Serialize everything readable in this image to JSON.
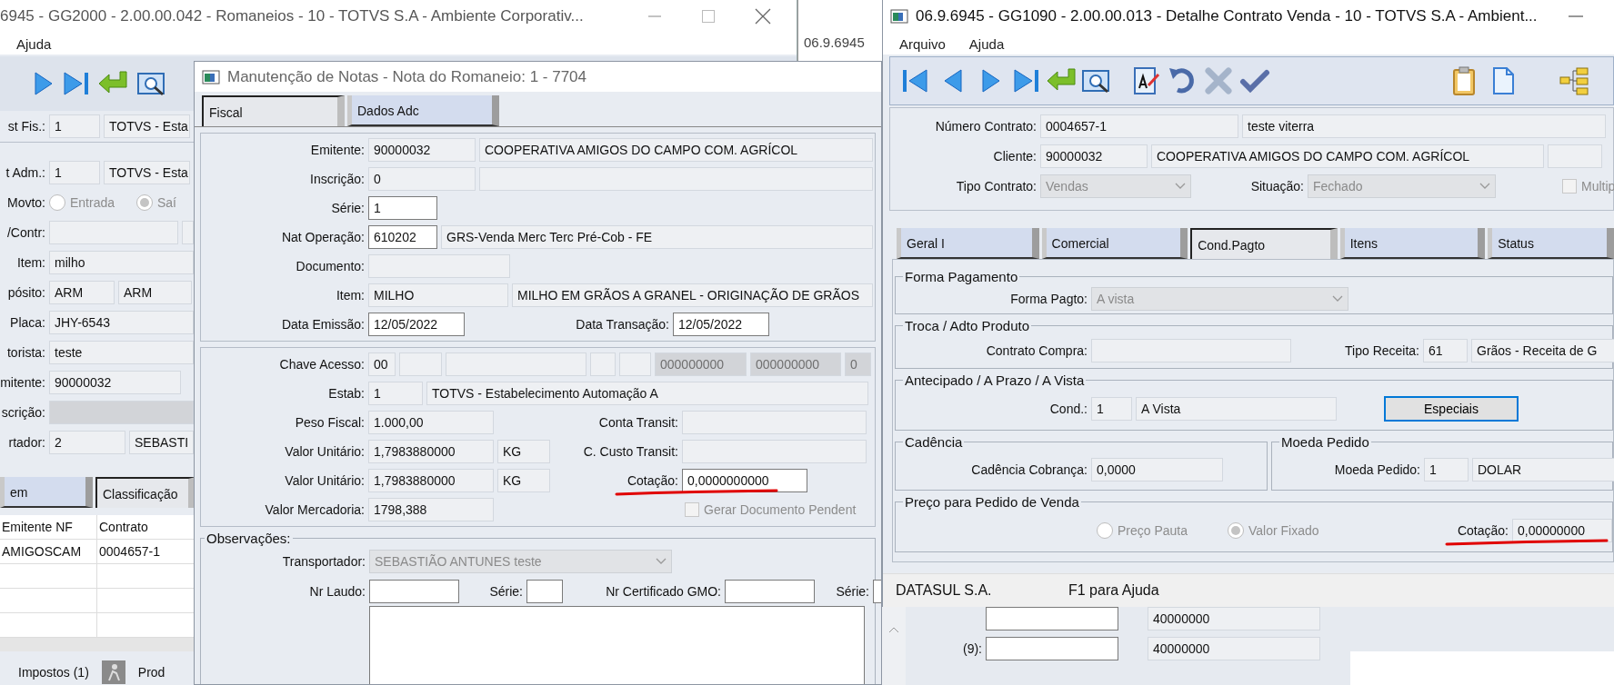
{
  "romaneios_window": {
    "title": "6945 - GG2000 - 2.00.00.042 - Romaneios - 10 - TOTVS S.A - Ambiente Corporativ...",
    "menu": [
      "Ajuda"
    ],
    "rows": [
      {
        "items": [
          {
            "kind": "label",
            "text": "st Fis.:"
          },
          {
            "kind": "readonly",
            "value": "1"
          },
          {
            "kind": "readonly",
            "value": "TOTVS - Esta"
          }
        ]
      },
      {
        "items": [
          {
            "kind": "label",
            "text": "t Adm.:"
          },
          {
            "kind": "readonly",
            "value": "1"
          },
          {
            "kind": "readonly",
            "value": "TOTVS - Esta"
          }
        ]
      },
      {
        "items": [
          {
            "kind": "label",
            "text": "Movto:"
          },
          {
            "kind": "radio",
            "label": "Entrada",
            "selected": false,
            "disabled": true
          },
          {
            "kind": "radio",
            "label": "Saí",
            "selected": true,
            "disabled": true
          }
        ]
      },
      {
        "items": [
          {
            "kind": "label",
            "text": "/Contr:"
          },
          {
            "kind": "readonly"
          },
          {
            "kind": "readonly"
          }
        ]
      },
      {
        "items": [
          {
            "kind": "label",
            "text": "Item:"
          },
          {
            "kind": "readonly",
            "value": "milho"
          }
        ]
      },
      {
        "items": [
          {
            "kind": "label",
            "text": "pósito:"
          },
          {
            "kind": "readonly",
            "value": "ARM"
          },
          {
            "kind": "readonly",
            "value": "ARM"
          }
        ]
      },
      {
        "items": [
          {
            "kind": "label",
            "text": "Placa:"
          },
          {
            "kind": "readonly",
            "value": "JHY-6543"
          }
        ]
      },
      {
        "items": [
          {
            "kind": "label",
            "text": "torista:"
          },
          {
            "kind": "readonly",
            "value": "teste"
          }
        ]
      },
      {
        "items": [
          {
            "kind": "label",
            "text": "mitente:"
          },
          {
            "kind": "readonly",
            "value": "90000032"
          }
        ]
      },
      {
        "items": [
          {
            "kind": "label",
            "text": "scrição:"
          },
          {
            "kind": "readonly",
            "disabled": true
          }
        ]
      },
      {
        "items": [
          {
            "kind": "label",
            "text": "rtador:"
          },
          {
            "kind": "readonly",
            "value": "2"
          },
          {
            "kind": "readonly",
            "value": "SEBASTI"
          }
        ]
      }
    ],
    "tabs": [
      {
        "label": "em",
        "selected": false
      },
      {
        "label": "Classificação",
        "selected": true
      }
    ],
    "table": {
      "columns": [
        "Emitente NF",
        "Contrato"
      ],
      "rows": [
        [
          "AMIGOSCAM",
          "0004657-1"
        ]
      ]
    },
    "bottom_bar": [
      "Impostos (1)",
      "Prod"
    ]
  },
  "background_window": {
    "title": "06.9.6945"
  },
  "behind_panel": {
    "rows": [
      {
        "items": [
          {
            "kind": "input"
          },
          {
            "kind": "readonly",
            "value": "40000000"
          }
        ]
      },
      {
        "items": [
          {
            "kind": "label",
            "text": "(9):"
          },
          {
            "kind": "input"
          },
          {
            "kind": "readonly",
            "value": "40000000"
          }
        ]
      }
    ]
  },
  "notes_window": {
    "title": "Manutenção de Notas - Nota do Romaneio: 1 - 7704",
    "tabs": [
      {
        "label": "Fiscal",
        "selected": true
      },
      {
        "label": "Dados Adc",
        "selected": false
      }
    ],
    "groups": [
      {
        "rows": [
          {
            "items": [
              {
                "kind": "label",
                "text": "Emitente:"
              },
              {
                "kind": "readonly",
                "value": "90000032"
              },
              {
                "kind": "readonly",
                "value": "COOPERATIVA AMIGOS DO CAMPO COM. AGRÍCOL"
              }
            ]
          },
          {
            "items": [
              {
                "kind": "label",
                "text": "Inscrição:"
              },
              {
                "kind": "readonly",
                "value": "0"
              },
              {
                "kind": "readonly"
              }
            ]
          },
          {
            "items": [
              {
                "kind": "label",
                "text": "Série:"
              },
              {
                "kind": "input",
                "value": "1"
              }
            ]
          },
          {
            "items": [
              {
                "kind": "label",
                "text": "Nat Operação:"
              },
              {
                "kind": "input",
                "value": "610202"
              },
              {
                "kind": "readonly",
                "value": "GRS-Venda Merc Terc Pré-Cob - FE"
              }
            ]
          },
          {
            "items": [
              {
                "kind": "label",
                "text": "Documento:"
              },
              {
                "kind": "readonly"
              }
            ]
          },
          {
            "items": [
              {
                "kind": "label",
                "text": "Item:"
              },
              {
                "kind": "readonly",
                "value": "MILHO"
              },
              {
                "kind": "readonly",
                "value": "MILHO EM GRÃOS A GRANEL - ORIGINAÇÃO DE GRÃOS"
              }
            ]
          },
          {
            "items": [
              {
                "kind": "label",
                "text": "Data Emissão:"
              },
              {
                "kind": "input",
                "value": "12/05/2022"
              },
              {
                "kind": "label",
                "text": "Data Transação:"
              },
              {
                "kind": "input",
                "value": "12/05/2022"
              }
            ]
          }
        ]
      },
      {
        "rows": [
          {
            "items": [
              {
                "kind": "label",
                "text": "Chave Acesso:"
              },
              {
                "kind": "readonly",
                "value": "00"
              },
              {
                "kind": "readonly"
              },
              {
                "kind": "readonly"
              },
              {
                "kind": "readonly"
              },
              {
                "kind": "readonly"
              },
              {
                "kind": "readonly",
                "value": "000000000",
                "disabled": true
              },
              {
                "kind": "readonly",
                "value": "000000000",
                "disabled": true
              },
              {
                "kind": "readonly",
                "value": "0",
                "disabled": true
              }
            ]
          },
          {
            "items": [
              {
                "kind": "label",
                "text": "Estab:"
              },
              {
                "kind": "readonly",
                "value": "1"
              },
              {
                "kind": "readonly",
                "value": "TOTVS - Estabelecimento Automação A"
              }
            ]
          },
          {
            "items": [
              {
                "kind": "label",
                "text": "Peso Fiscal:"
              },
              {
                "kind": "readonly",
                "value": "1.000,00"
              },
              {
                "kind": "label",
                "text": "Conta Transit:"
              },
              {
                "kind": "readonly"
              }
            ]
          },
          {
            "items": [
              {
                "kind": "label",
                "text": "Valor Unitário:"
              },
              {
                "kind": "readonly",
                "value": "1,7983880000"
              },
              {
                "kind": "readonly",
                "value": "KG"
              },
              {
                "kind": "label",
                "text": "C. Custo Transit:"
              },
              {
                "kind": "readonly"
              }
            ]
          },
          {
            "items": [
              {
                "kind": "label",
                "text": "Valor Unitário:"
              },
              {
                "kind": "readonly",
                "value": "1,7983880000"
              },
              {
                "kind": "readonly",
                "value": "KG"
              },
              {
                "kind": "label",
                "text": "Cotação:",
                "highlighted": true
              },
              {
                "kind": "input",
                "value": "0,0000000000"
              }
            ]
          },
          {
            "items": [
              {
                "kind": "label",
                "text": "Valor Mercadoria:"
              },
              {
                "kind": "readonly",
                "value": "1798,388"
              },
              {
                "kind": "checkbox",
                "label": "Gerar Documento Pendent",
                "checked": false,
                "disabled": true
              }
            ]
          }
        ]
      },
      {
        "title": "Observações:",
        "rows": [
          {
            "items": [
              {
                "kind": "label",
                "text": "Transportador:"
              },
              {
                "kind": "select",
                "value": "SEBASTIÃO ANTUNES teste",
                "disabled": true
              }
            ]
          },
          {
            "items": [
              {
                "kind": "label",
                "text": "Nr Laudo:"
              },
              {
                "kind": "input"
              },
              {
                "kind": "label",
                "text": "Série:"
              },
              {
                "kind": "input"
              },
              {
                "kind": "label",
                "text": "Nr Certificado GMO:"
              },
              {
                "kind": "input"
              },
              {
                "kind": "label",
                "text": "Série:"
              },
              {
                "kind": "input"
              }
            ]
          },
          {
            "items": [
              {
                "kind": "textarea"
              }
            ]
          }
        ]
      }
    ]
  },
  "contract_window": {
    "title": "06.9.6945 - GG1090 - 2.00.00.013 - Detalhe Contrato Venda - 10 - TOTVS S.A - Ambient...",
    "menu": [
      "Arquivo",
      "Ajuda"
    ],
    "header_rows": [
      {
        "items": [
          {
            "kind": "label",
            "text": "Número Contrato:"
          },
          {
            "kind": "readonly",
            "value": "0004657-1"
          },
          {
            "kind": "readonly",
            "value": "teste viterra"
          }
        ]
      },
      {
        "items": [
          {
            "kind": "label",
            "text": "Cliente:"
          },
          {
            "kind": "readonly",
            "value": "90000032"
          },
          {
            "kind": "readonly",
            "value": "COOPERATIVA AMIGOS DO CAMPO COM. AGRÍCOL"
          },
          {
            "kind": "readonly"
          }
        ]
      },
      {
        "items": [
          {
            "kind": "label",
            "text": "Tipo Contrato:"
          },
          {
            "kind": "select",
            "value": "Vendas",
            "disabled": true
          },
          {
            "kind": "label",
            "text": "Situação:"
          },
          {
            "kind": "select",
            "value": "Fechado",
            "disabled": true
          },
          {
            "kind": "checkbox",
            "label": "Multip",
            "checked": false,
            "disabled": true
          }
        ]
      }
    ],
    "tabs": [
      {
        "label": "Geral I",
        "selected": false
      },
      {
        "label": "Comercial",
        "selected": false
      },
      {
        "label": "Cond.Pagto",
        "selected": true
      },
      {
        "label": "Itens",
        "selected": false
      },
      {
        "label": "Status",
        "selected": false
      }
    ],
    "group_rows": [
      {
        "groups": [
          {
            "title": "Forma Pagamento",
            "rows": [
              {
                "items": [
                  {
                    "kind": "label",
                    "text": "Forma Pagto:"
                  },
                  {
                    "kind": "select",
                    "value": "A vista",
                    "disabled": true
                  }
                ]
              }
            ]
          }
        ]
      },
      {
        "groups": [
          {
            "title": "Troca / Adto Produto",
            "rows": [
              {
                "items": [
                  {
                    "kind": "label",
                    "text": "Contrato Compra:"
                  },
                  {
                    "kind": "readonly"
                  },
                  {
                    "kind": "label",
                    "text": "Tipo Receita:"
                  },
                  {
                    "kind": "readonly",
                    "value": "61"
                  },
                  {
                    "kind": "readonly",
                    "value": "Grãos - Receita de G"
                  }
                ]
              }
            ]
          }
        ]
      },
      {
        "groups": [
          {
            "title": "Antecipado / A Prazo / A Vista",
            "rows": [
              {
                "items": [
                  {
                    "kind": "label",
                    "text": "Cond.:"
                  },
                  {
                    "kind": "readonly",
                    "value": "1"
                  },
                  {
                    "kind": "readonly",
                    "value": "A Vista"
                  },
                  {
                    "kind": "button",
                    "label": "Especiais"
                  }
                ]
              }
            ]
          }
        ]
      },
      {
        "groups": [
          {
            "title": "Cadência",
            "rows": [
              {
                "items": [
                  {
                    "kind": "label",
                    "text": "Cadência Cobrança:"
                  },
                  {
                    "kind": "readonly",
                    "value": "0,0000"
                  }
                ]
              }
            ]
          },
          {
            "title": "Moeda Pedido",
            "rows": [
              {
                "items": [
                  {
                    "kind": "label",
                    "text": "Moeda Pedido:"
                  },
                  {
                    "kind": "readonly",
                    "value": "1"
                  },
                  {
                    "kind": "readonly",
                    "value": "DOLAR"
                  }
                ]
              }
            ]
          }
        ]
      },
      {
        "groups": [
          {
            "title": "Preço para Pedido de Venda",
            "rows": [
              {
                "items": [
                  {
                    "kind": "radio",
                    "label": "Preço Pauta",
                    "selected": false,
                    "disabled": true
                  },
                  {
                    "kind": "radio",
                    "label": "Valor Fixado",
                    "selected": true,
                    "disabled": true
                  },
                  {
                    "kind": "label",
                    "text": "Cotação:",
                    "highlighted": true
                  },
                  {
                    "kind": "readonly",
                    "value": "0,00000000"
                  }
                ]
              }
            ]
          }
        ]
      }
    ],
    "status_bar": [
      "DATASUL S.A.",
      "F1 para Ajuda"
    ]
  }
}
